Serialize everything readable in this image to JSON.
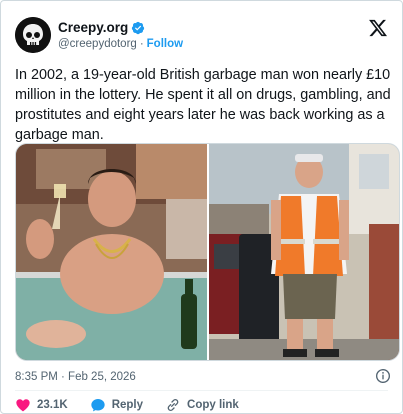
{
  "author": {
    "display_name": "Creepy.org",
    "handle": "@creepydotorg",
    "separator": "·",
    "follow_label": "Follow",
    "verified": true
  },
  "tweet": {
    "text": "In 2002, a 19-year-old British garbage man won nearly £10 million in the lottery. He spent it all on drugs, gambling, and prostitutes and eight years later he was back working as a garbage man."
  },
  "media": {
    "count": 2,
    "left_photo": "man-in-hot-tub-with-champagne",
    "right_photo": "man-in-high-vis-vest-with-wheelie-bin"
  },
  "meta": {
    "timestamp": "8:35 PM · Feb 25, 2026"
  },
  "actions": {
    "likes": "23.1K",
    "reply_label": "Reply",
    "copy_link_label": "Copy link"
  },
  "colors": {
    "accent": "#1d9bf0",
    "like": "#f91880",
    "text": "#0f1419",
    "muted": "#536471",
    "border": "#cfd9de"
  }
}
